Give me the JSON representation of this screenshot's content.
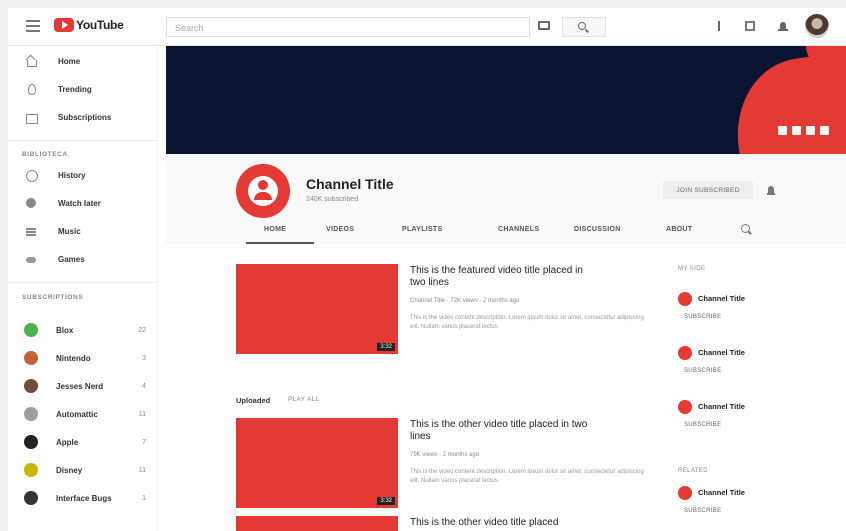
{
  "topbar": {
    "logo_text": "YouTube",
    "search_placeholder": "Search"
  },
  "sidebar": {
    "main_items": [
      {
        "label": "Home"
      },
      {
        "label": "Trending"
      },
      {
        "label": "Subscriptions"
      }
    ],
    "library_heading": "BIBLIOTECA",
    "library_items": [
      {
        "label": "History"
      },
      {
        "label": "Watch later"
      },
      {
        "label": "Music"
      },
      {
        "label": "Games"
      }
    ],
    "subscriptions_heading": "SUBSCRIPTIONS",
    "subscriptions": [
      {
        "label": "Blox",
        "count": "22",
        "color": "#4caf50"
      },
      {
        "label": "Nintendo",
        "count": "3",
        "color": "#c0633a"
      },
      {
        "label": "Jesses Nerd",
        "count": "4",
        "color": "#6d4c41"
      },
      {
        "label": "Automattic",
        "count": "11",
        "color": "#9e9e9e"
      },
      {
        "label": "Apple",
        "count": "7",
        "color": "#222222"
      },
      {
        "label": "Disney",
        "count": "11",
        "color": "#c9b400"
      },
      {
        "label": "Interface Bugs",
        "count": "1",
        "color": "#333333"
      }
    ]
  },
  "channel": {
    "title": "Channel Title",
    "subscribers": "240K subscribed",
    "join_label": "JOIN SUBSCRIBED",
    "accent": "#e53935",
    "banner_color": "#0a1330",
    "tabs": [
      "HOME",
      "VIDEOS",
      "PLAYLISTS",
      "CHANNELS",
      "DISCUSSION",
      "ABOUT"
    ]
  },
  "featured": {
    "title": "This is the featured video title placed in two lines",
    "meta": "Channel Title · 72K views · 2 months ago",
    "description": "This is the video content description. Lorem ipsum dolor sit amet, consectetur adipiscing elit. Nullam varius placerat lectus.",
    "duration": "3:32"
  },
  "uploads": {
    "heading": "Uploaded",
    "play_all": "PLAY ALL",
    "videos": [
      {
        "title": "This is the other video title placed in two lines",
        "meta": "79K views · 2 months ago",
        "description": "This is the video content description. Lorem ipsum dolor sit amet, consectetur adipiscing elit. Nullam varius placerat lectus.",
        "duration": "3:32"
      },
      {
        "title": "This is the other video title placed"
      }
    ]
  },
  "side_channels": {
    "my_heading": "MY SIDE",
    "related_heading": "RELATED",
    "subscribe_label": "SUBSCRIBE",
    "channels": [
      {
        "name": "Channel Title"
      },
      {
        "name": "Channel Title"
      },
      {
        "name": "Channel Title"
      }
    ],
    "related": [
      {
        "name": "Channel Title"
      }
    ]
  }
}
